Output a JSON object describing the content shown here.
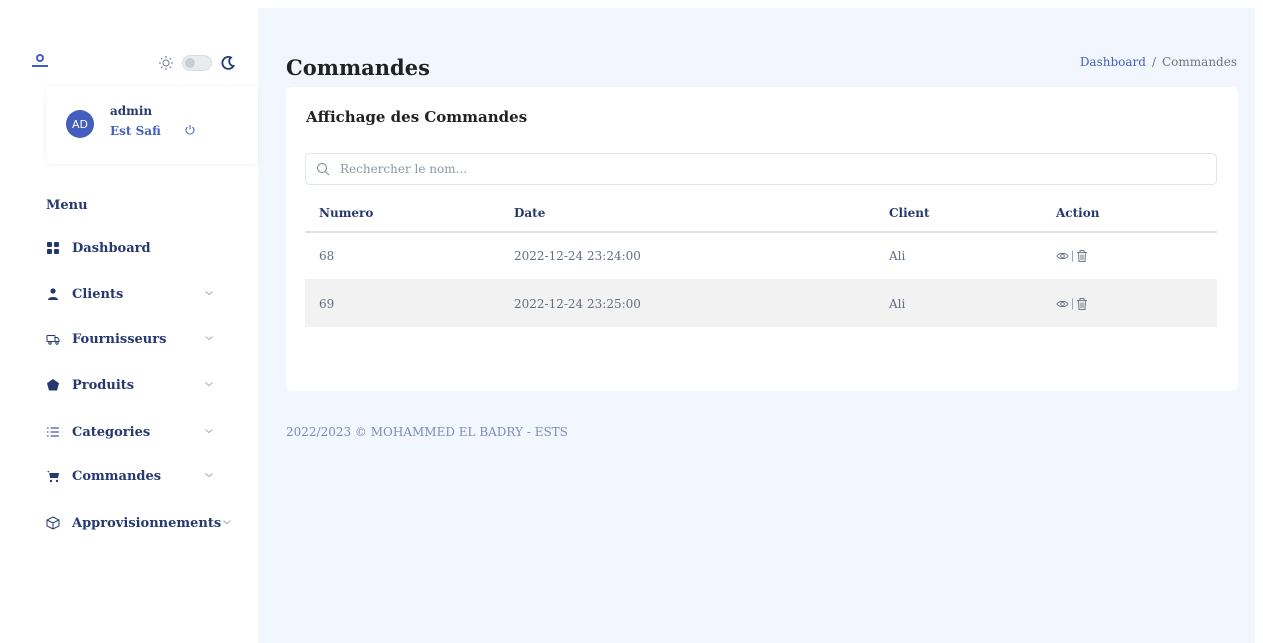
{
  "sidebar": {
    "user": {
      "initials": "AD",
      "name": "admin",
      "organization": "Est Safi"
    },
    "menu_title": "Menu",
    "items": [
      {
        "label": "Dashboard",
        "icon": "grid-icon",
        "has_submenu": false
      },
      {
        "label": "Clients",
        "icon": "person-icon",
        "has_submenu": true
      },
      {
        "label": "Fournisseurs",
        "icon": "truck-icon",
        "has_submenu": true
      },
      {
        "label": "Produits",
        "icon": "pentagon-icon",
        "has_submenu": true
      },
      {
        "label": "Categories",
        "icon": "list-icon",
        "has_submenu": true
      },
      {
        "label": "Commandes",
        "icon": "cart-icon",
        "has_submenu": true
      },
      {
        "label": "Approvisionnements",
        "icon": "box-icon",
        "has_submenu": true
      }
    ]
  },
  "header": {
    "title": "Commandes",
    "breadcrumb": {
      "parent": "Dashboard",
      "separator": "/",
      "current": "Commandes"
    }
  },
  "card": {
    "title": "Affichage des Commandes",
    "search_placeholder": "Rechercher le nom...",
    "columns": [
      "Numero",
      "Date",
      "Client",
      "Action"
    ],
    "rows": [
      {
        "numero": "68",
        "date": "2022-12-24 23:24:00",
        "client": "Ali"
      },
      {
        "numero": "69",
        "date": "2022-12-24 23:25:00",
        "client": "Ali"
      }
    ]
  },
  "footer": {
    "text": "2022/2023 © MOHAMMED EL BADRY - ESTS"
  },
  "colors": {
    "primary": "#435ebe",
    "text": "#25396f",
    "background": "#f2f7ff"
  }
}
